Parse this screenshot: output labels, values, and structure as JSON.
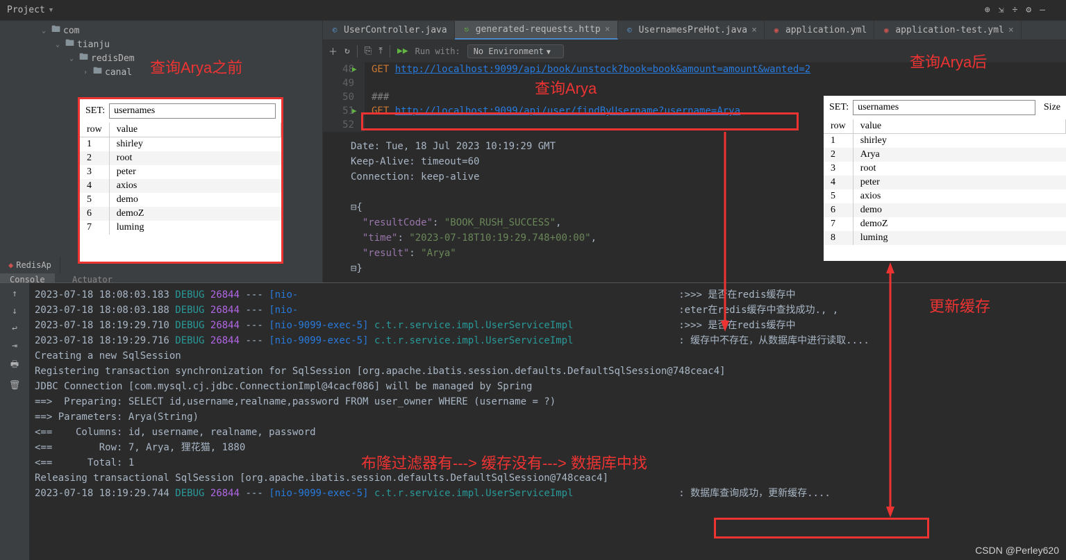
{
  "project_label": "Project",
  "tree": {
    "com": "com",
    "tianju": "tianju",
    "redis": "redisDem",
    "canal": "canal"
  },
  "tabs": [
    {
      "label": "UserController.java",
      "type": "java"
    },
    {
      "label": "generated-requests.http",
      "type": "http",
      "active": true
    },
    {
      "label": "UsernamesPreHot.java",
      "type": "java"
    },
    {
      "label": "application.yml",
      "type": "yml"
    },
    {
      "label": "application-test.yml",
      "type": "yml"
    }
  ],
  "toolbar": {
    "run_with": "Run with:",
    "env": "No Environment"
  },
  "code": {
    "lines": [
      {
        "num": "48",
        "play": true,
        "method": "GET",
        "url": "http://localhost:9099/api/book/unstock?book=book&amount=amount&wanted=2"
      },
      {
        "num": "49"
      },
      {
        "num": "50",
        "hash": "###"
      },
      {
        "num": "51",
        "play": true,
        "method": "GET",
        "url": "http://localhost:9099/api/user/findByUsername?username=Arya"
      },
      {
        "num": "52"
      }
    ]
  },
  "response": {
    "date": "Date: Tue, 18 Jul 2023 10:19:29 GMT",
    "keepalive": "Keep-Alive: timeout=60",
    "connection": "Connection: keep-alive",
    "body": {
      "resultCode_k": "\"resultCode\"",
      "resultCode_v": "\"BOOK_RUSH_SUCCESS\"",
      "time_k": "\"time\"",
      "time_v": "\"2023-07-18T10:19:29.748+00:00\"",
      "result_k": "\"result\"",
      "result_v": "\"Arya\""
    }
  },
  "redis_left": {
    "label": "SET:",
    "value": "usernames",
    "cols": [
      "row",
      "value"
    ],
    "rows": [
      [
        "1",
        "shirley"
      ],
      [
        "2",
        "root"
      ],
      [
        "3",
        "peter"
      ],
      [
        "4",
        "axios"
      ],
      [
        "5",
        "demo"
      ],
      [
        "6",
        "demoZ"
      ],
      [
        "7",
        "luming"
      ]
    ]
  },
  "redis_right": {
    "label": "SET:",
    "value": "usernames",
    "size": "Size",
    "cols": [
      "row",
      "value"
    ],
    "rows": [
      [
        "1",
        "shirley"
      ],
      [
        "2",
        "Arya"
      ],
      [
        "3",
        "root"
      ],
      [
        "4",
        "peter"
      ],
      [
        "5",
        "axios"
      ],
      [
        "6",
        "demo"
      ],
      [
        "7",
        "demoZ"
      ],
      [
        "8",
        "luming"
      ]
    ]
  },
  "bottom_tabs": {
    "redis": "RedisAp",
    "console": "Console",
    "actuator": "Actuator"
  },
  "console": [
    {
      "ts": "2023-07-18 18:08:03.183",
      "lvl": "DEBUG",
      "pid": "26844",
      "sep": "---",
      "thr": "[nio-",
      "msg_tail": ":>>> 是否在redis缓存中"
    },
    {
      "ts": "2023-07-18 18:08:03.188",
      "lvl": "DEBUG",
      "pid": "26844",
      "sep": "---",
      "thr": "[nio-",
      "msg_tail": ":eter在redis缓存中查找成功., ,"
    },
    {
      "ts": "2023-07-18 18:19:29.710",
      "lvl": "DEBUG",
      "pid": "26844",
      "sep": "---",
      "thr": "[nio-9099-exec-5]",
      "cls": "c.t.r.service.impl.UserServiceImpl",
      "msg_tail": ":>>> 是否在redis缓存中"
    },
    {
      "ts": "2023-07-18 18:19:29.716",
      "lvl": "DEBUG",
      "pid": "26844",
      "sep": "---",
      "thr": "[nio-9099-exec-5]",
      "cls": "c.t.r.service.impl.UserServiceImpl",
      "msg_tail": ": 缓存中不存在，从数据库中进行读取...."
    },
    {
      "plain": "Creating a new SqlSession"
    },
    {
      "plain": "Registering transaction synchronization for SqlSession [org.apache.ibatis.session.defaults.DefaultSqlSession@748ceac4]"
    },
    {
      "plain": "JDBC Connection [com.mysql.cj.jdbc.ConnectionImpl@4cacf086] will be managed by Spring"
    },
    {
      "plain": "==>  Preparing: SELECT id,username,realname,password FROM user_owner WHERE (username = ?)"
    },
    {
      "plain": "==> Parameters: Arya(String)"
    },
    {
      "plain": "<==    Columns: id, username, realname, password"
    },
    {
      "plain": "<==        Row: 7, Arya, 狸花猫, 1880"
    },
    {
      "plain": "<==      Total: 1"
    },
    {
      "plain": "Releasing transactional SqlSession [org.apache.ibatis.session.defaults.DefaultSqlSession@748ceac4]"
    },
    {
      "ts": "2023-07-18 18:19:29.744",
      "lvl": "DEBUG",
      "pid": "26844",
      "sep": "---",
      "thr": "[nio-9099-exec-5]",
      "cls": "c.t.r.service.impl.UserServiceImpl",
      "msg_tail": ": 数据库查询成功，更新缓存...."
    }
  ],
  "annotations": {
    "before": "查询Arya之前",
    "query": "查询Arya",
    "after": "查询Arya后",
    "update_cache": "更新缓存",
    "flow": "布隆过滤器有---> 缓存没有---> 数据库中找"
  },
  "watermark": "CSDN @Perley620"
}
